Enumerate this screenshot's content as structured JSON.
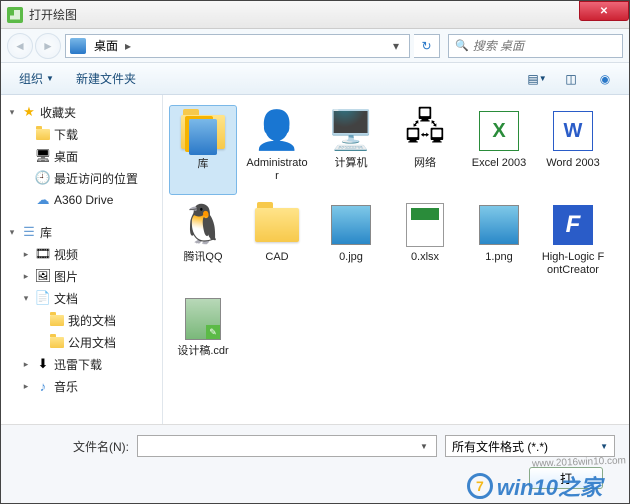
{
  "window_title": "打开绘图",
  "breadcrumb": {
    "location": "桌面"
  },
  "search": {
    "placeholder": "搜索 桌面"
  },
  "toolbar": {
    "organize": "组织",
    "new_folder": "新建文件夹"
  },
  "sidebar": {
    "favorites": {
      "label": "收藏夹",
      "items": [
        "下载",
        "桌面",
        "最近访问的位置",
        "A360 Drive"
      ]
    },
    "libraries": {
      "label": "库",
      "items": [
        {
          "label": "视频",
          "children": []
        },
        {
          "label": "图片",
          "children": []
        },
        {
          "label": "文档",
          "children": [
            "我的文档",
            "公用文档"
          ]
        },
        {
          "label": "迅雷下载",
          "children": []
        },
        {
          "label": "音乐",
          "children": []
        }
      ]
    }
  },
  "files": [
    {
      "name": "库",
      "type": "library",
      "selected": true
    },
    {
      "name": "Administrator",
      "type": "user"
    },
    {
      "name": "计算机",
      "type": "computer"
    },
    {
      "name": "网络",
      "type": "network"
    },
    {
      "name": "Excel 2003",
      "type": "excel"
    },
    {
      "name": "Word 2003",
      "type": "word"
    },
    {
      "name": "腾讯QQ",
      "type": "qq"
    },
    {
      "name": "CAD",
      "type": "folder"
    },
    {
      "name": "0.jpg",
      "type": "image"
    },
    {
      "name": "0.xlsx",
      "type": "xlsx"
    },
    {
      "name": "1.png",
      "type": "png"
    },
    {
      "name": "High-Logic FontCreator",
      "type": "fontcreator"
    },
    {
      "name": "设计稿.cdr",
      "type": "cdr"
    }
  ],
  "footer": {
    "filename_label": "文件名(N):",
    "filetype": "所有文件格式 (*.*)",
    "open_label": "打"
  },
  "watermark": {
    "text": "win10之家",
    "url": "www.2016win10.com"
  }
}
